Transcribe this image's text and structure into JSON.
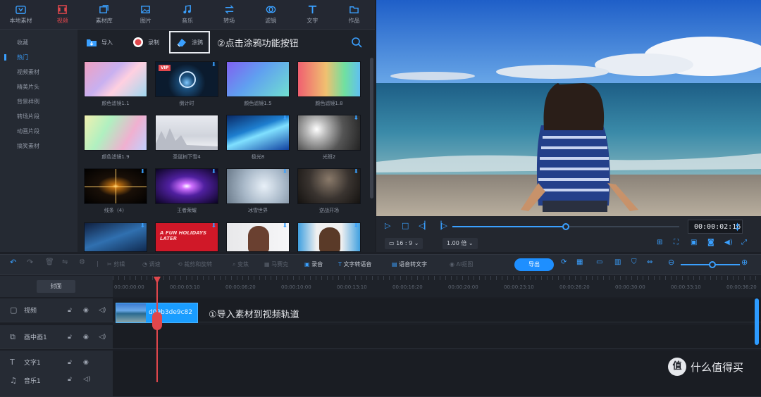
{
  "colors": {
    "accent": "#3aa0ff",
    "active_tab": "#e0474c",
    "export": "#1e8fff",
    "highlight_box": "#e8ebf0",
    "playhead": "#e0474c"
  },
  "topnav": [
    {
      "label": "本地素材",
      "icon": "local-media-icon"
    },
    {
      "label": "视频",
      "icon": "video-icon"
    },
    {
      "label": "素材库",
      "icon": "library-icon"
    },
    {
      "label": "图片",
      "icon": "image-icon"
    },
    {
      "label": "音乐",
      "icon": "music-icon"
    },
    {
      "label": "转场",
      "icon": "transition-icon"
    },
    {
      "label": "滤镜",
      "icon": "filter-icon"
    },
    {
      "label": "文字",
      "icon": "text-icon"
    },
    {
      "label": "作品",
      "icon": "folder-icon"
    }
  ],
  "categories": [
    "收藏",
    "热门",
    "视频素材",
    "精美片头",
    "背景样例",
    "转场片段",
    "动画片段",
    "搞笑素材"
  ],
  "library_toolbar": {
    "import": "导入",
    "record": "录制",
    "doodle": "涂鸦"
  },
  "annotation2": "②点击涂鸦功能按钮",
  "annotation1": "①导入素材到视频轨道",
  "cards": [
    {
      "label": "颜色滤镜1.1",
      "download": false
    },
    {
      "label": "倒计时",
      "download": true,
      "badge": "VIP"
    },
    {
      "label": "颜色滤镜1.5",
      "download": false
    },
    {
      "label": "颜色滤镜1.8",
      "download": false
    },
    {
      "label": "颜色滤镜1.9",
      "download": false
    },
    {
      "label": "圣诞树下雪4",
      "download": false
    },
    {
      "label": "极光8",
      "download": true
    },
    {
      "label": "光斑2",
      "download": true
    },
    {
      "label": "线条（4）",
      "download": true
    },
    {
      "label": "王者荣耀",
      "download": true
    },
    {
      "label": "冰雪世界",
      "download": true
    },
    {
      "label": "逆战开场",
      "download": true
    },
    {
      "label": "",
      "download": true
    },
    {
      "label": "",
      "download": true,
      "text": "A FUN HOLIDAYS LATER"
    },
    {
      "label": "",
      "download": true
    },
    {
      "label": "",
      "download": true
    }
  ],
  "preview": {
    "time": "00:00:02:16",
    "ratio": "16 : 9",
    "speed": "1.00 倍",
    "progress": 0.5
  },
  "edit_toolbar": {
    "items": [
      "剪辑",
      "调速",
      "裁剪和旋转",
      "变焦",
      "马赛克",
      "录音",
      "文字转语音",
      "语音转文字",
      "AI抠图"
    ],
    "export": "导出"
  },
  "timeline": {
    "cover": "封面",
    "ticks": [
      "00:00:00:00",
      "00:00:03:10",
      "00:00:06:20",
      "00:00:10:00",
      "00:00:13:10",
      "00:00:16:20",
      "00:00:20:00",
      "00:00:23:10",
      "00:00:26:20",
      "00:00:30:00",
      "00:00:33:10",
      "00:00:36:20"
    ],
    "tracks": [
      {
        "label": "视频",
        "icon": "video-track-icon"
      },
      {
        "label": "画中画1",
        "icon": "pip-track-icon"
      },
      {
        "label": "文字1",
        "icon": "text-track-icon"
      },
      {
        "label": "音乐1",
        "icon": "music-track-icon"
      }
    ],
    "clip_name": "d09b3de9c82"
  },
  "watermark": {
    "logo": "值",
    "text": "什么值得买"
  }
}
